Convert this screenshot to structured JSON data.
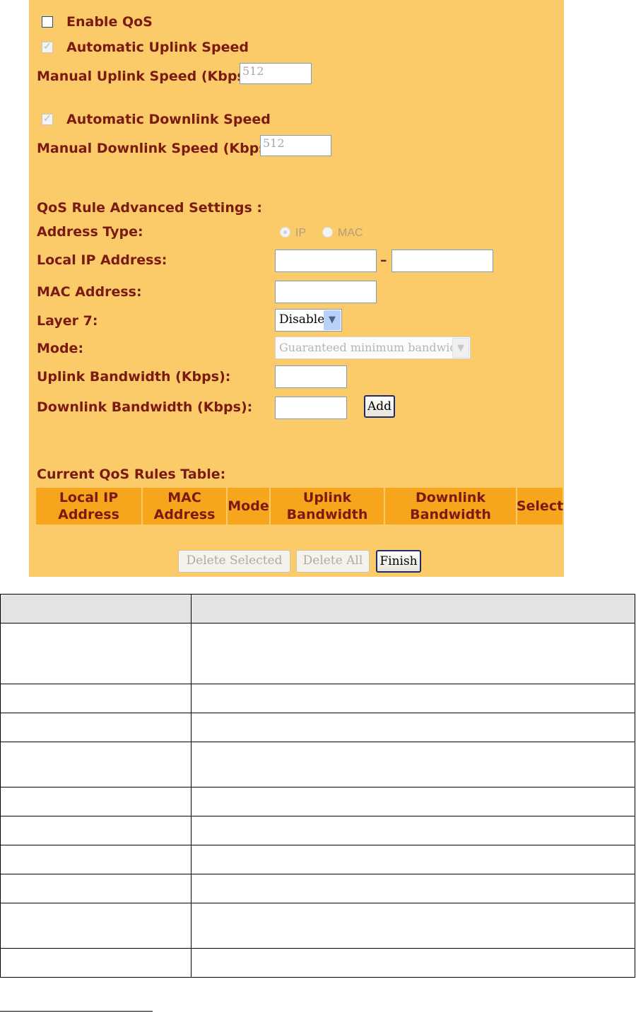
{
  "qos": {
    "enable_qos_label": "Enable QoS",
    "auto_uplink_label": "Automatic Uplink Speed",
    "manual_uplink_label": "Manual Uplink Speed (Kbps) :",
    "manual_uplink_value": "512",
    "auto_downlink_label": "Automatic Downlink Speed",
    "manual_downlink_label": "Manual Downlink Speed (Kbps) :",
    "manual_downlink_value": "512"
  },
  "rule": {
    "heading": "QoS Rule Advanced Settings :",
    "address_type_label": "Address Type:",
    "ip_option": "IP",
    "mac_option": "MAC",
    "local_ip_label": "Local IP Address:",
    "ip_range_separator": "–",
    "mac_label": "MAC Address:",
    "layer7_label": "Layer 7:",
    "layer7_value": "Disable",
    "mode_label": "Mode:",
    "mode_value": "Guaranteed minimum bandwidth",
    "uplink_bw_label": "Uplink Bandwidth (Kbps):",
    "downlink_bw_label": "Downlink Bandwidth (Kbps):",
    "add_button": "Add"
  },
  "rules_table": {
    "title": "Current QoS Rules Table:",
    "columns": [
      "Local IP\nAddress",
      "MAC\nAddress",
      "Mode",
      "Uplink\nBandwidth",
      "Downlink\nBandwidth",
      "Select"
    ]
  },
  "actions": {
    "delete_selected": "Delete Selected",
    "delete_all": "Delete All",
    "finish": "Finish"
  },
  "colors": {
    "panel_bg": "#fbcb69",
    "label_text": "#7a1a10",
    "table_header_bg": "#f7a51c"
  }
}
